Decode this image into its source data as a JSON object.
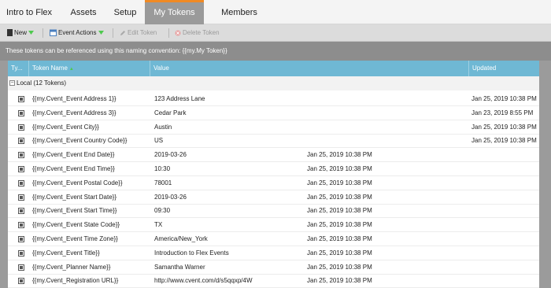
{
  "tabs": [
    {
      "label": "Intro to Flex",
      "active": false
    },
    {
      "label": "Assets",
      "active": false
    },
    {
      "label": "Setup",
      "active": false
    },
    {
      "label": "My Tokens",
      "active": true
    },
    {
      "label": "Members",
      "active": false
    }
  ],
  "toolbar": {
    "new_label": "New",
    "event_actions_label": "Event Actions",
    "edit_token_label": "Edit Token",
    "delete_token_label": "Delete Token"
  },
  "banner": {
    "text": "These tokens can be referenced using this naming convention: {{my.My Token}}"
  },
  "grid": {
    "columns": {
      "type": "Ty...",
      "name": "Token Name",
      "value": "Value",
      "updated": "Updated"
    },
    "group_label": "Local (12 Tokens)",
    "rows": [
      {
        "name": "{{my.Cvent_Event Address 1}}",
        "value": "123 Address Lane",
        "date_mid": "",
        "date_right": "Jan 25, 2019 10:38 PM"
      },
      {
        "name": "{{my.Cvent_Event Address 3}}",
        "value": "Cedar Park",
        "date_mid": "",
        "date_right": "Jan 23, 2019 8:55 PM"
      },
      {
        "name": "{{my.Cvent_Event City}}",
        "value": "Austin",
        "date_mid": "",
        "date_right": "Jan 25, 2019 10:38 PM"
      },
      {
        "name": "{{my.Cvent_Event Country Code}}",
        "value": "US",
        "date_mid": "",
        "date_right": "Jan 25, 2019 10:38 PM"
      },
      {
        "name": "{{my.Cvent_Event End Date}}",
        "value": "2019-03-26",
        "date_mid": "Jan 25, 2019 10:38 PM",
        "date_right": ""
      },
      {
        "name": "{{my.Cvent_Event End Time}}",
        "value": "10:30",
        "date_mid": "Jan 25, 2019 10:38 PM",
        "date_right": ""
      },
      {
        "name": "{{my.Cvent_Event Postal Code}}",
        "value": "78001",
        "date_mid": "Jan 25, 2019 10:38 PM",
        "date_right": ""
      },
      {
        "name": "{{my.Cvent_Event Start Date}}",
        "value": "2019-03-26",
        "date_mid": "Jan 25, 2019 10:38 PM",
        "date_right": ""
      },
      {
        "name": "{{my.Cvent_Event Start Time}}",
        "value": "09:30",
        "date_mid": "Jan 25, 2019 10:38 PM",
        "date_right": ""
      },
      {
        "name": "{{my.Cvent_Event State Code}}",
        "value": "TX",
        "date_mid": "Jan 25, 2019 10:38 PM",
        "date_right": ""
      },
      {
        "name": "{{my.Cvent_Event Time Zone}}",
        "value": "America/New_York",
        "date_mid": "Jan 25, 2019 10:38 PM",
        "date_right": ""
      },
      {
        "name": "{{my.Cvent_Event Title}}",
        "value": "Introduction to Flex Events",
        "date_mid": "Jan 25, 2019 10:38 PM",
        "date_right": ""
      },
      {
        "name": "{{my.Cvent_Planner Name}}",
        "value": "Samantha Warner",
        "date_mid": "Jan 25, 2019 10:38 PM",
        "date_right": ""
      },
      {
        "name": "{{my.Cvent_Registration URL}}",
        "value": "http://www.cvent.com/d/s5qqxp/4W",
        "date_mid": "Jan 25, 2019 10:38 PM",
        "date_right": ""
      }
    ]
  },
  "colors": {
    "accent": "#f08a24",
    "header": "#6fb8d4",
    "banner": "#8d8d8d",
    "green": "#4ec94e"
  }
}
